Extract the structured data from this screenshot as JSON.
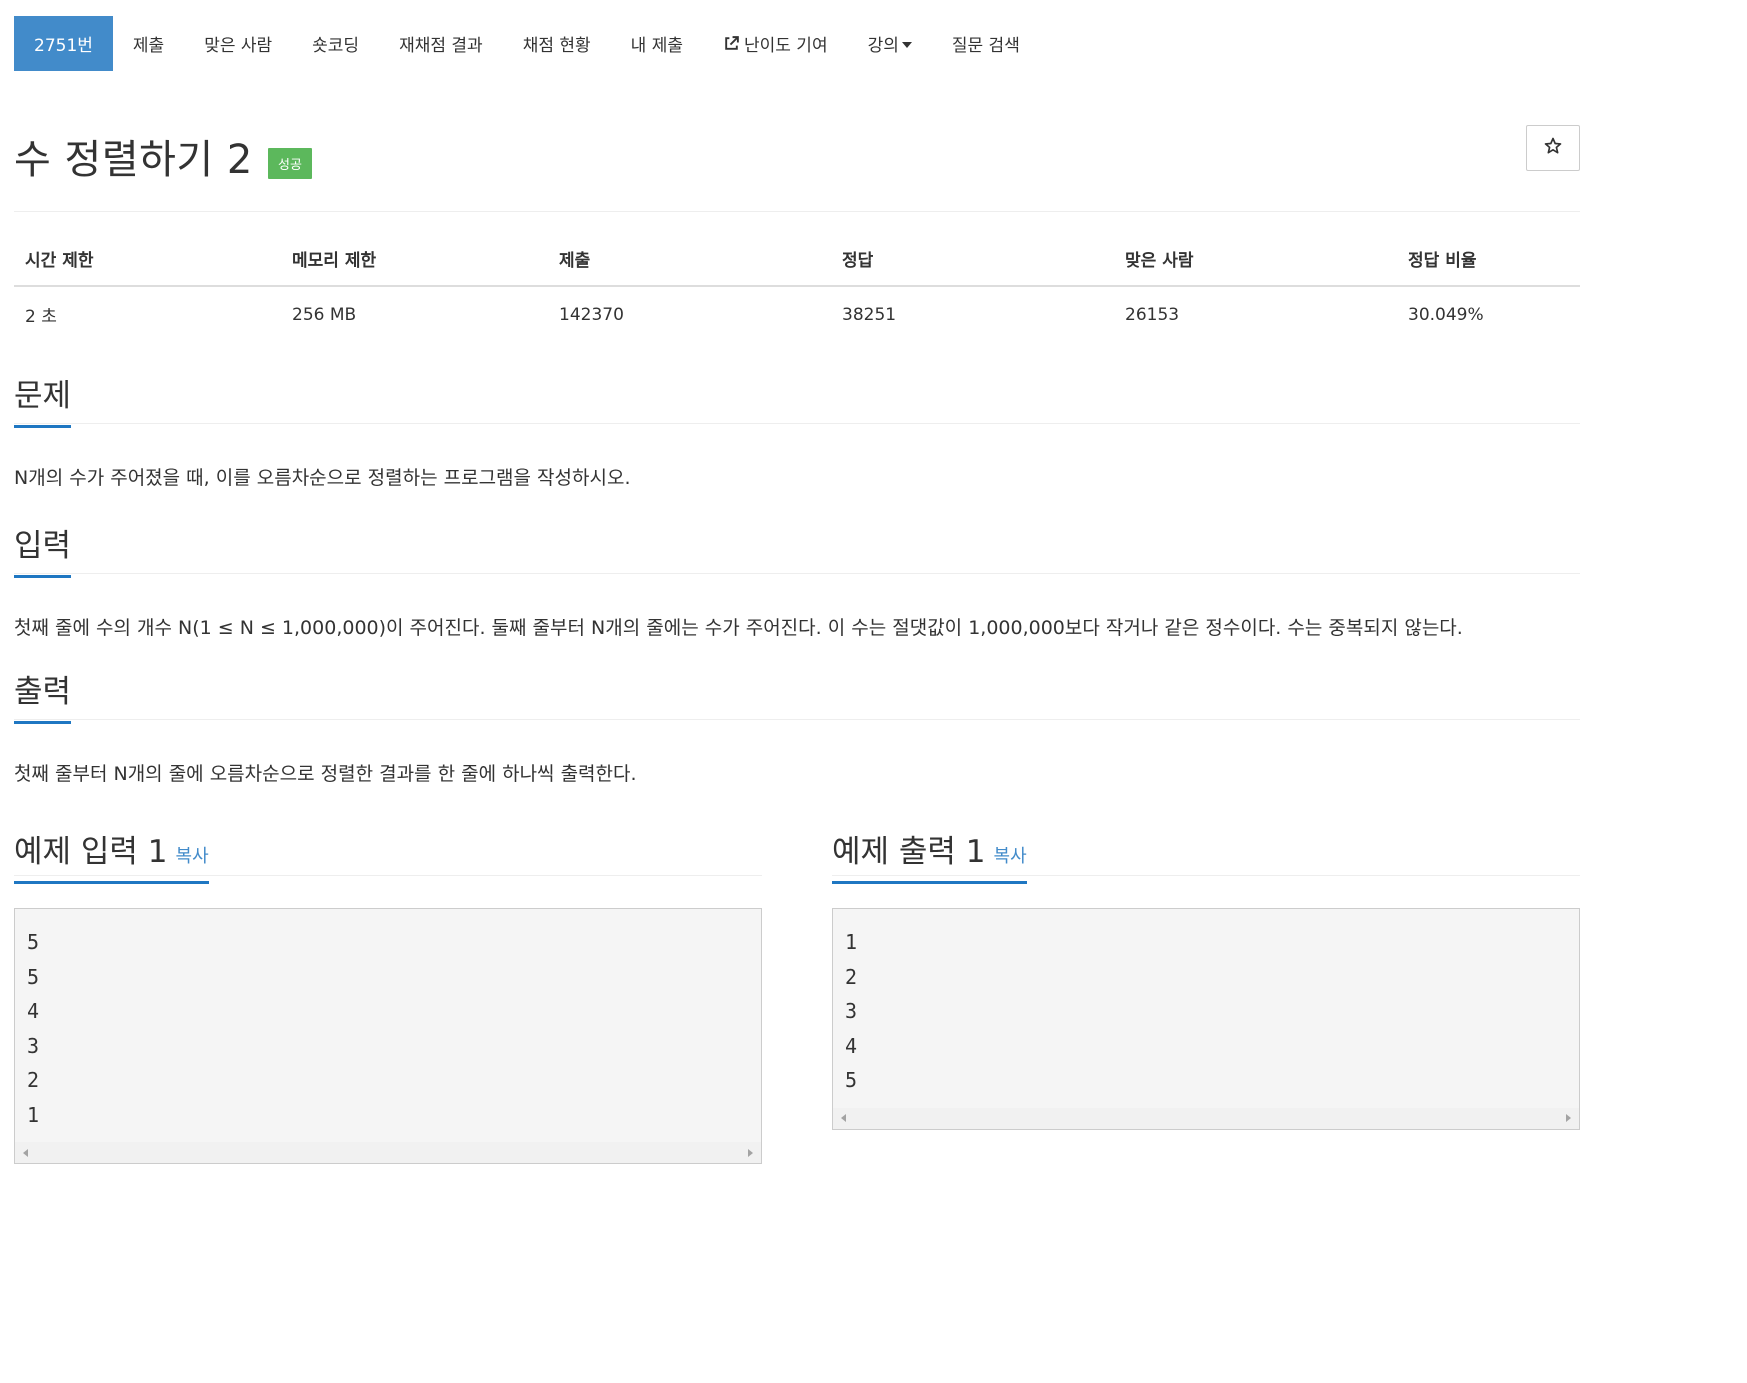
{
  "tabs": [
    {
      "label": "2751번",
      "active": true
    },
    {
      "label": "제출"
    },
    {
      "label": "맞은 사람"
    },
    {
      "label": "숏코딩"
    },
    {
      "label": "재채점 결과"
    },
    {
      "label": "채점 현황"
    },
    {
      "label": "내 제출"
    },
    {
      "label": "난이도 기여",
      "icon": "external-link-icon"
    },
    {
      "label": "강의",
      "icon": "caret-down-icon"
    },
    {
      "label": "질문 검색"
    }
  ],
  "problem": {
    "title": "수 정렬하기 2",
    "badge": "성공",
    "star_icon": "star-icon"
  },
  "info_table": {
    "headers": [
      "시간 제한",
      "메모리 제한",
      "제출",
      "정답",
      "맞은 사람",
      "정답 비율"
    ],
    "values": [
      "2 초",
      "256 MB",
      "142370",
      "38251",
      "26153",
      "30.049%"
    ]
  },
  "sections": {
    "problem": {
      "heading": "문제",
      "text": "N개의 수가 주어졌을 때, 이를 오름차순으로 정렬하는 프로그램을 작성하시오."
    },
    "input": {
      "heading": "입력",
      "text": "첫째 줄에 수의 개수 N(1 ≤ N ≤ 1,000,000)이 주어진다. 둘째 줄부터 N개의 줄에는 수가 주어진다. 이 수는 절댓값이 1,000,000보다 작거나 같은 정수이다. 수는 중복되지 않는다."
    },
    "output": {
      "heading": "출력",
      "text": "첫째 줄부터 N개의 줄에 오름차순으로 정렬한 결과를 한 줄에 하나씩 출력한다."
    }
  },
  "samples": {
    "input": {
      "heading": "예제 입력 1",
      "copy": "복사",
      "lines": [
        "5",
        "5",
        "4",
        "3",
        "2",
        "1"
      ]
    },
    "output": {
      "heading": "예제 출력 1",
      "copy": "복사",
      "lines": [
        "1",
        "2",
        "3",
        "4",
        "5"
      ]
    }
  },
  "colors": {
    "active_tab": "#428bca",
    "success_badge": "#5cb85c",
    "section_underline": "#1f77c2"
  }
}
